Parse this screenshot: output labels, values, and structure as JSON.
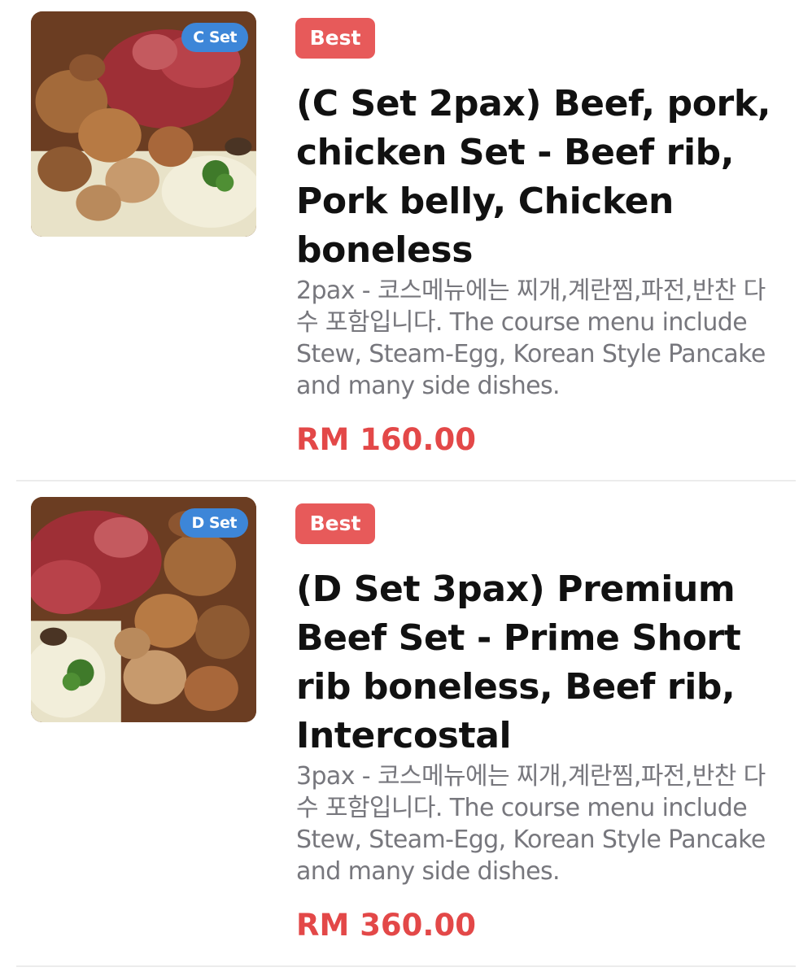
{
  "items": [
    {
      "set_badge": "C Set",
      "tag": "Best",
      "title": "(C Set 2pax) Beef, pork, chicken Set - Beef rib, Pork belly, Chicken boneless",
      "description": "2pax - 코스메뉴에는 찌개,계란찜,파전,반찬 다수 포함입니다. The course menu include Stew, Steam-Egg, Korean Style Pancake and many side dishes.",
      "price": "RM 160.00"
    },
    {
      "set_badge": "D Set",
      "tag": "Best",
      "title": "(D Set 3pax) Premium Beef Set - Prime Short rib boneless, Beef rib, Intercostal",
      "description": "3pax - 코스메뉴에는 찌개,계란찜,파전,반찬 다수 포함입니다. The course menu include Stew, Steam-Egg, Korean Style Pancake and many side dishes.",
      "price": "RM 360.00"
    }
  ],
  "colors": {
    "best_tag": "#e75a5a",
    "set_badge": "#3d86d8",
    "price": "#e34848",
    "description": "#77777d",
    "title": "#111111"
  }
}
